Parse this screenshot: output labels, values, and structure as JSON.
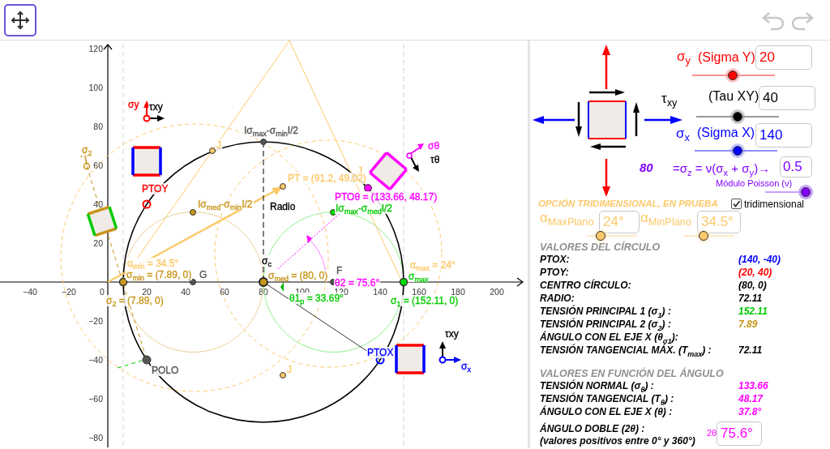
{
  "toolbar": {
    "tools": [
      {
        "kind": "move",
        "selected": true
      }
    ],
    "history": [
      {
        "kind": "undo",
        "disabled": true
      },
      {
        "kind": "redo",
        "disabled": true
      }
    ]
  },
  "graph": {
    "x_ticks": [
      "−40",
      "−20",
      "0",
      "20",
      "40",
      "60",
      "80",
      "100",
      "120",
      "140",
      "160",
      "180",
      "200"
    ],
    "y_ticks": [
      "120",
      "100",
      "80",
      "60",
      "40",
      "20",
      "−20",
      "−40",
      "−60",
      "−80"
    ],
    "labels": [
      {
        "text": "σy",
        "color": "#ff0000"
      },
      {
        "text": "τxy",
        "color": "#000000"
      },
      {
        "text": "Iσ$_{max}$-σ$_{min}$I/2",
        "color": "#555555"
      },
      {
        "text": "J",
        "color": "#fcc96a"
      },
      {
        "text": "σθ",
        "color": "#ff00ff"
      },
      {
        "text": "σ$_{2}$",
        "color": "#c8961e"
      },
      {
        "text": "τθ",
        "color": "#000000"
      },
      {
        "text": "J",
        "color": "#fcc96a"
      },
      {
        "text": "PT = (91.2, 49.02)",
        "color": "#fcc96a"
      },
      {
        "text": "PTOY",
        "color": "#ff0000"
      },
      {
        "text": "PTOθ = (133.66, 48.17)",
        "color": "#ff00ff"
      },
      {
        "text": "Iσ$_{med}$-σ$_{min}$I/2",
        "color": "#c8961e"
      },
      {
        "text": "Radio",
        "color": "#000000"
      },
      {
        "text": "Iσ$_{max}$-σ$_{med}$I/2",
        "color": "#00cc00"
      },
      {
        "text": "α$_{min}$ = 34.5°",
        "color": "#fcc96a"
      },
      {
        "text": "σ$_{c}$",
        "color": "#000000"
      },
      {
        "text": "α$_{max}$ = 24°",
        "color": "#fcc96a"
      },
      {
        "text": "F",
        "color": "#555555"
      },
      {
        "text": "σ$_{min}$ = (7.89, 0)",
        "color": "#c8961e"
      },
      {
        "text": "G",
        "color": "#555555"
      },
      {
        "text": "σ$_{med}$ = (80, 0)",
        "color": "#c8961e"
      },
      {
        "text": "σ$_{max}$",
        "color": "#00cc00"
      },
      {
        "text": "θ2 = 75.6°",
        "color": "#ff00ff"
      },
      {
        "text": "σ$_{2}$ = (7.89, 0)",
        "color": "#c8961e"
      },
      {
        "text": "θ1$_{p}$ = 33.69°",
        "color": "#00cc00"
      },
      {
        "text": "σ$_{1}$ = (152.11, 0)",
        "color": "#00cc00"
      },
      {
        "text": "τxy",
        "color": "#000000"
      },
      {
        "text": "PTOX",
        "color": "#0000ff"
      },
      {
        "text": "POLO",
        "color": "#555555"
      },
      {
        "text": "J",
        "color": "#fcc96a"
      },
      {
        "text": "σ$_{x}$",
        "color": "#0000ff"
      }
    ]
  },
  "panel": {
    "inputs": [
      {
        "symbol": "σ$_{y}$",
        "name": "(Sigma Y)",
        "value": "20",
        "color": "#ff0000",
        "level": 0.49
      },
      {
        "symbol": "τ$_{xy}$",
        "name": "(Tau XY)",
        "value": "40",
        "color": "#000000",
        "level": 0.5
      },
      {
        "symbol": "σ$_{x}$",
        "name": "(Sigma X)",
        "value": "140",
        "color": "#0000ff",
        "level": 0.52
      }
    ],
    "sigma_z": {
      "value": "80",
      "formula": "=σ$_{z}$ = ν(σ$_{x}$ + σ$_{y}$)→",
      "poisson": "0.5",
      "poisson_label": "Módulo Poisson (ν)",
      "level": 0.93
    },
    "tridimensional": {
      "title": "OPCIÓN TRIDIMENSIONAL, EN PRUEBA",
      "label": "tridimensional",
      "checked": true
    },
    "planes": [
      {
        "symbol": "α$_{MaxPlano}$",
        "value": "24°",
        "level": 0.27
      },
      {
        "symbol": "α$_{MinPlano}$",
        "value": "34.5°",
        "level": 0.39
      }
    ],
    "circle_values": {
      "title": "VALORES DEL CÍRCULO",
      "rows": [
        {
          "label": "PTOX:",
          "value": "(140, -40)",
          "color": "#0000ff"
        },
        {
          "label": "PTOY:",
          "value": "(20, 40)",
          "color": "#ff0000"
        },
        {
          "label": "CENTRO CÍRCULO:",
          "value": "(80, 0)",
          "color": "#000000"
        },
        {
          "label": "RADIO:",
          "value": "72.11",
          "color": "#000000"
        },
        {
          "label": "TENSIÓN PRINCIPAL 1 (σ$_{1}$) :",
          "value": "152.11",
          "color": "#00cc00"
        },
        {
          "label": "TENSIÓN PRINCIPAL 2 (σ$_{2}$) :",
          "value": "7.89",
          "color": "#c8961e"
        },
        {
          "label": "ÁNGULO CON EL EJE X (θ$_{σ1}$):"
        },
        {
          "label": "TENSIÓN TANGENCIAL MÁX. (T$_{max}$) :",
          "value": "72.11",
          "color": "#000000"
        }
      ]
    },
    "angle_values": {
      "title": "VALORES EN FUNCIÓN DEL ÁNGULO",
      "rows": [
        {
          "label": "TENSIÓN NORMAL (σ$_{θ}$) :",
          "value": "133.66",
          "color": "#ff00ff"
        },
        {
          "label": "TENSIÓN TANGENCIAL (T$_{θ}$) :",
          "value": "48.17",
          "color": "#ff00ff"
        },
        {
          "label": "ÁNGULO CON EL EJE X (θ) :",
          "value": "37.8°",
          "color": "#ff00ff"
        }
      ],
      "double_angle": {
        "label": "ÁNGULO DOBLE (2θ) :",
        "symbol": "2θ",
        "value": "75.6°",
        "note": "(valores positivos entre 0° y 360°)"
      }
    }
  }
}
